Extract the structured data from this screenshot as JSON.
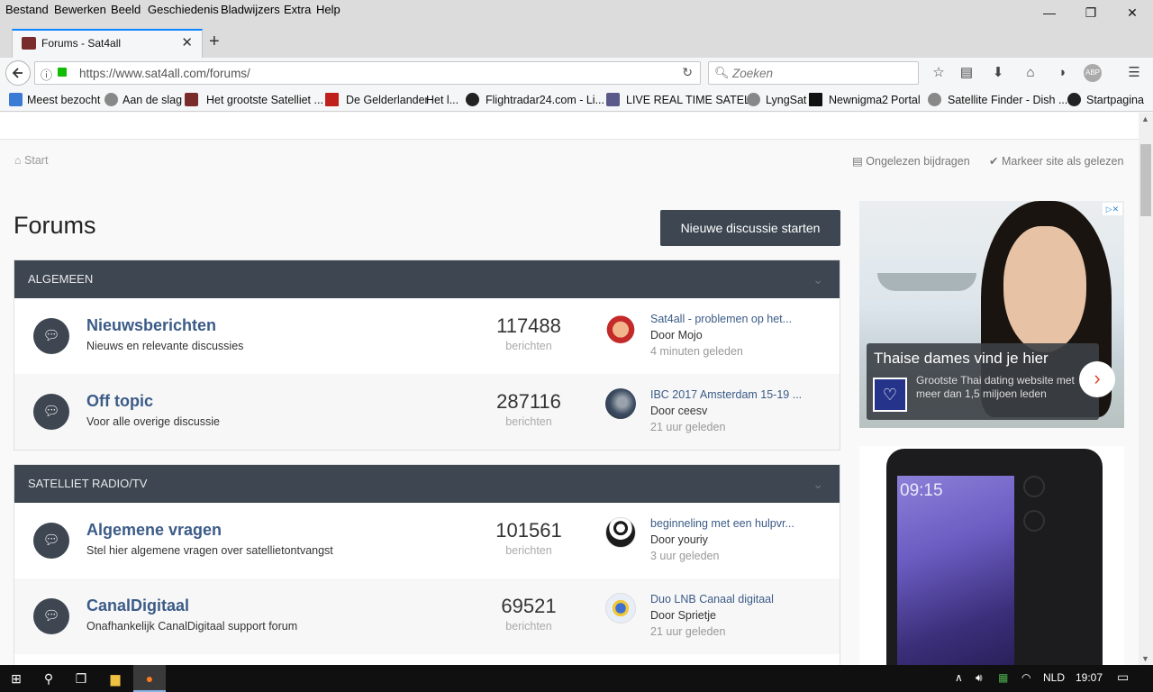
{
  "menubar": {
    "items": [
      "Bestand",
      "Bewerken",
      "Beeld",
      "Geschiedenis",
      "Bladwijzers",
      "Extra",
      "Help"
    ]
  },
  "window_controls": {
    "minimize": "—",
    "restore": "❐",
    "close": "✕"
  },
  "tab": {
    "title": "Forums - Sat4all",
    "close": "✕",
    "new_tab": "+"
  },
  "navbar": {
    "url": "https://www.sat4all.com/forums/",
    "search_placeholder": "Zoeken"
  },
  "bookmarks": [
    "Meest bezocht",
    "Aan de slag",
    "Het grootste Satelliet ...",
    "De Gelderlander",
    "Het l...",
    "Flightradar24.com - Li...",
    "LIVE REAL TIME SATEL...",
    "LyngSat",
    "Newnigma2",
    "Portal",
    "Satellite Finder - Dish ...",
    "Startpagina"
  ],
  "page": {
    "breadcrumb": "Start",
    "unread_link": "Ongelezen bijdragen",
    "mark_read_link": "Markeer site als gelezen",
    "title": "Forums",
    "new_discussion_button": "Nieuwe discussie starten",
    "categories": [
      {
        "name": "ALGEMEEN",
        "forums": [
          {
            "title": "Nieuwsberichten",
            "desc": "Nieuws en relevante discussies",
            "count": "117488",
            "count_label": "berichten",
            "last_title": "Sat4all - problemen op het...",
            "last_by": "Door Mojo",
            "last_time": "4 minuten geleden"
          },
          {
            "title": "Off topic",
            "desc": "Voor alle overige discussie",
            "count": "287116",
            "count_label": "berichten",
            "last_title": "IBC 2017 Amsterdam 15-19 ...",
            "last_by": "Door ceesv",
            "last_time": "21 uur geleden"
          }
        ]
      },
      {
        "name": "SATELLIET RADIO/TV",
        "forums": [
          {
            "title": "Algemene vragen",
            "desc": "Stel hier algemene vragen over satellietontvangst",
            "count": "101561",
            "count_label": "berichten",
            "last_title": "beginneling met een hulpvr...",
            "last_by": "Door youriy",
            "last_time": "3 uur geleden"
          },
          {
            "title": "CanalDigitaal",
            "desc": "Onafhankelijk CanalDigitaal support forum",
            "count": "69521",
            "count_label": "berichten",
            "last_title": "Duo LNB Canaal digitaal",
            "last_by": "Door Sprietje",
            "last_time": "21 uur geleden"
          }
        ]
      }
    ]
  },
  "ads": {
    "ad1_headline": "Thaise dames vind je hier",
    "ad1_body": "Grootste Thai dating website met meer dan 1,5 miljoen leden",
    "ad2_phone_time": "09:15"
  },
  "taskbar": {
    "language": "NLD",
    "clock": "19:07"
  }
}
